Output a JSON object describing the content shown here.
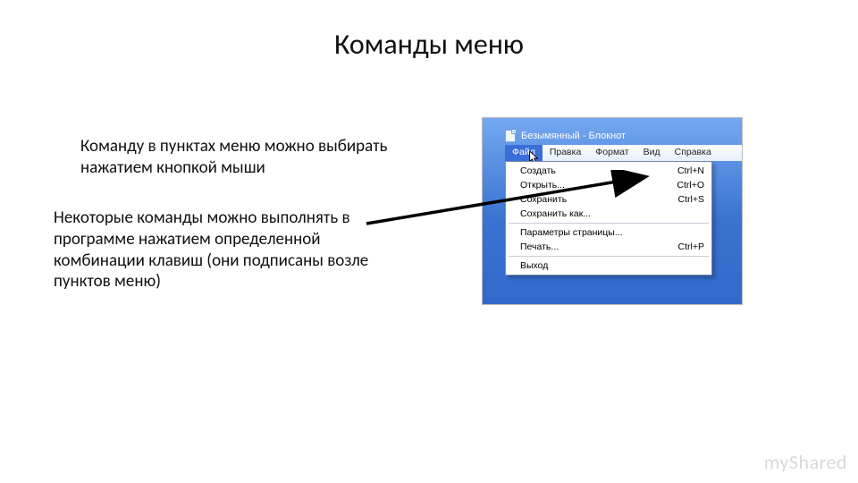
{
  "title": "Команды меню",
  "para1": "Команду в пунктах меню можно выбирать нажатием кнопкой мыши",
  "para2": "Некоторые команды можно выполнять в программе нажатием определенной комбинации клавиш (они подписаны возле пунктов меню)",
  "watermark": "myShared",
  "notepad": {
    "window_title": "Безымянный - Блокнот",
    "menubar": [
      "Файл",
      "Правка",
      "Формат",
      "Вид",
      "Справка"
    ],
    "active_menu_index": 0,
    "dropdown": [
      {
        "label": "Создать",
        "shortcut": "Ctrl+N"
      },
      {
        "label": "Открыть...",
        "shortcut": "Ctrl+O"
      },
      {
        "label": "Сохранить",
        "shortcut": "Ctrl+S"
      },
      {
        "label": "Сохранить как...",
        "shortcut": ""
      },
      {
        "sep": true
      },
      {
        "label": "Параметры страницы...",
        "shortcut": ""
      },
      {
        "label": "Печать...",
        "shortcut": "Ctrl+P"
      },
      {
        "sep": true
      },
      {
        "label": "Выход",
        "shortcut": ""
      }
    ]
  }
}
